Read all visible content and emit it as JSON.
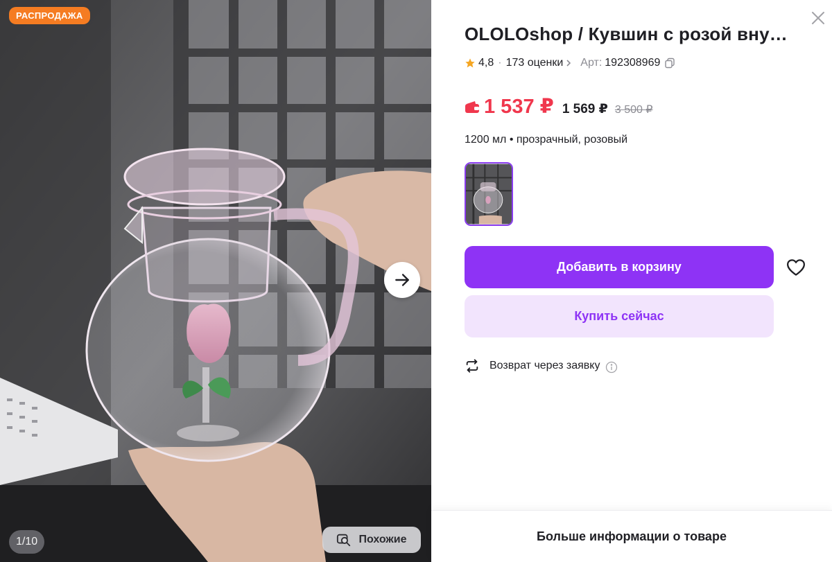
{
  "gallery": {
    "badge": "РАСПРОДАЖА",
    "counter": "1/10",
    "similar_label": "Похожие",
    "icons": {
      "next": "arrow-right-icon",
      "similar": "similar-search-icon"
    }
  },
  "product": {
    "title": "OLOLOshop / Кувшин с розой вну…",
    "rating": "4,8",
    "separator": "·",
    "reviews": "173 оценки",
    "sku_label": "Арт:",
    "sku": "192308969",
    "price": "1 537 ₽",
    "price_card": "1 569 ₽",
    "price_old": "3 500 ₽",
    "variant": "1200 мл • прозрачный, розовый"
  },
  "actions": {
    "add_to_cart": "Добавить в корзину",
    "buy_now": "Купить сейчас",
    "returns": "Возврат через заявку",
    "more_info": "Больше информации о товаре"
  },
  "colors": {
    "accent": "#8e33f5",
    "accent_light": "#f2e4fd",
    "price_red": "#f0374d",
    "badge_orange": "#f57c22"
  }
}
